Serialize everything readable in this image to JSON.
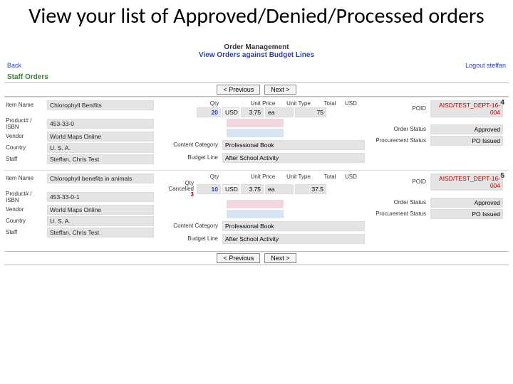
{
  "slide_title": "View your list of Approved/Denied/Processed orders",
  "app": {
    "header": "Order Management",
    "subheader": "View Orders against Budget Lines",
    "back": "Back",
    "logout_prefix": "Logout ",
    "logout_user": "steffan",
    "section_label": "Staff Orders",
    "prev": "< Previous",
    "next": "Next >"
  },
  "labels": {
    "item_name": "Item Name",
    "product_isbn": "Product# / ISBN",
    "vendor": "Vendor",
    "country": "Country",
    "staff": "Staff",
    "qty": "Qty",
    "unit_price": "Unit Price",
    "unit_type": "Unit Type",
    "total": "Total",
    "qty_cancelled": "Qty Cancelled",
    "content_category": "Content Category",
    "budget_line": "Budget Line",
    "poid": "POID",
    "order_status": "Order Status",
    "procurement_status": "Procurement Status"
  },
  "orders": [
    {
      "index": "4",
      "item_name": "Chlorophyll Benifits",
      "product_isbn": "453-33-0",
      "vendor": "World Maps Online",
      "country": "U. S. A.",
      "staff": "Steffan, Chris Test",
      "qty": "20",
      "currency": "USD",
      "unit_price": "3.75",
      "unit_type": "ea",
      "total_currency": "USD",
      "total": "75",
      "qty_cancelled": "",
      "content_category": "Professional Book",
      "budget_line": "After School Activity",
      "poid": "AISD/TEST_DEPT-16-004",
      "order_status": "Approved",
      "procurement_status": "PO Issued"
    },
    {
      "index": "5",
      "item_name": "Chlorophyll benefits in animals",
      "product_isbn": "453-33-0-1",
      "vendor": "World Maps Online",
      "country": "U. S. A.",
      "staff": "Steffan, Chris Test",
      "qty": "10",
      "currency": "USD",
      "unit_price": "3.75",
      "unit_type": "ea",
      "total_currency": "USD",
      "total": "37.5",
      "qty_cancelled": "3",
      "content_category": "Professional Book",
      "budget_line": "After School Activity",
      "poid": "AISD/TEST_DEPT-16-004",
      "order_status": "Approved",
      "procurement_status": "PO Issued"
    }
  ]
}
